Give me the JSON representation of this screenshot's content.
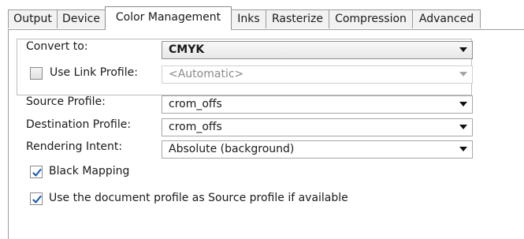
{
  "tabs": [
    {
      "label": "Output"
    },
    {
      "label": "Device"
    },
    {
      "label": "Color Management"
    },
    {
      "label": "Inks"
    },
    {
      "label": "Rasterize"
    },
    {
      "label": "Compression"
    },
    {
      "label": "Advanced"
    }
  ],
  "active_tab": "Color Management",
  "convert": {
    "label": "Convert to:",
    "value": "CMYK"
  },
  "link_profile": {
    "label": "Use Link Profile:",
    "checked": false,
    "value": "<Automatic>"
  },
  "source_profile": {
    "label": "Source Profile:",
    "value": "crom_offs"
  },
  "destination_profile": {
    "label": "Destination Profile:",
    "value": "crom_offs"
  },
  "rendering_intent": {
    "label": "Rendering Intent:",
    "value": "Absolute (background)"
  },
  "black_mapping": {
    "label": "Black Mapping",
    "checked": true
  },
  "use_document_profile": {
    "label": "Use the document profile as Source profile if available",
    "checked": true
  },
  "colors": {
    "check_accent": "#1f5fb4"
  }
}
